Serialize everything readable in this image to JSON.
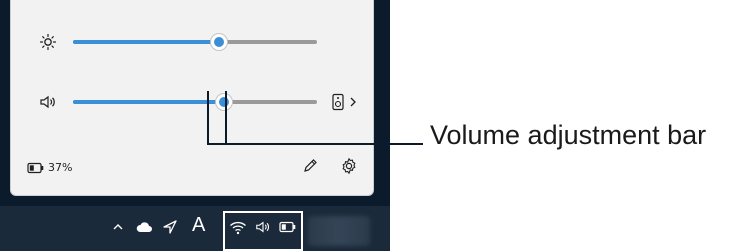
{
  "panel": {
    "brightness": {
      "icon": "sun-icon",
      "level_fraction": 0.6
    },
    "volume": {
      "icon": "speaker-icon",
      "level_fraction": 0.62,
      "output_icon": "speaker-device-icon",
      "expand_icon": "chevron-right-icon"
    },
    "battery": {
      "icon": "battery-icon",
      "text": "37%"
    },
    "edit_icon": "pencil-icon",
    "settings_icon": "gear-icon"
  },
  "taskbar": {
    "icons": [
      "chevron-up-icon",
      "cloud-icon",
      "navigation-arrow-icon",
      "keyboard-language-icon",
      "wifi-icon",
      "speaker-icon",
      "battery-icon"
    ],
    "language_label": "A"
  },
  "callout": {
    "label": "Volume adjustment bar"
  },
  "colors": {
    "accent": "#3a8fd6",
    "frame": "#0b1b2c",
    "panel": "#f2f2f2",
    "taskbar": "#1b2a3a"
  }
}
